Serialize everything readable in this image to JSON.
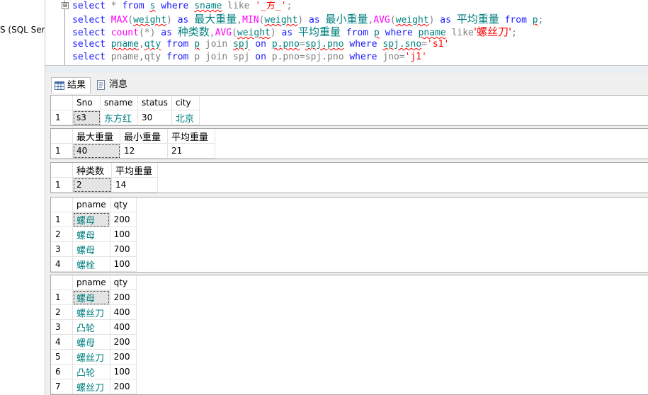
{
  "explorer": {
    "item_label": "S (SQL Ser"
  },
  "editor": {
    "collapse_symbol": "⊟",
    "lines": [
      [
        {
          "t": "select",
          "c": "kw"
        },
        {
          "t": " * ",
          "c": "gray"
        },
        {
          "t": "from",
          "c": "kw"
        },
        {
          "t": " ",
          "c": ""
        },
        {
          "t": "s",
          "c": "id sq"
        },
        {
          "t": " ",
          "c": ""
        },
        {
          "t": "where",
          "c": "kw"
        },
        {
          "t": " ",
          "c": ""
        },
        {
          "t": "sname",
          "c": "id sq"
        },
        {
          "t": " like ",
          "c": "gray"
        },
        {
          "t": "'_方_'",
          "c": "str"
        },
        {
          "t": ";",
          "c": "gray"
        }
      ],
      [
        {
          "t": "select",
          "c": "kw"
        },
        {
          "t": " ",
          "c": ""
        },
        {
          "t": "MAX",
          "c": "fn"
        },
        {
          "t": "(",
          "c": "gray"
        },
        {
          "t": "weight",
          "c": "id sq"
        },
        {
          "t": ") ",
          "c": "gray"
        },
        {
          "t": "as",
          "c": "kw"
        },
        {
          "t": " ",
          "c": ""
        },
        {
          "t": "最大重量",
          "c": "cjk"
        },
        {
          "t": ",",
          "c": "gray"
        },
        {
          "t": "MIN",
          "c": "fn"
        },
        {
          "t": "(",
          "c": "gray"
        },
        {
          "t": "weight",
          "c": "id sq"
        },
        {
          "t": ") ",
          "c": "gray"
        },
        {
          "t": "as",
          "c": "kw"
        },
        {
          "t": " ",
          "c": ""
        },
        {
          "t": "最小重量",
          "c": "cjk"
        },
        {
          "t": ",",
          "c": "gray"
        },
        {
          "t": "AVG",
          "c": "fn"
        },
        {
          "t": "(",
          "c": "gray"
        },
        {
          "t": "weight",
          "c": "id sq"
        },
        {
          "t": ") ",
          "c": "gray"
        },
        {
          "t": "as",
          "c": "kw"
        },
        {
          "t": " ",
          "c": ""
        },
        {
          "t": "平均重量",
          "c": "cjk"
        },
        {
          "t": " ",
          "c": ""
        },
        {
          "t": "from",
          "c": "kw"
        },
        {
          "t": " ",
          "c": ""
        },
        {
          "t": "p",
          "c": "id sq"
        },
        {
          "t": ";",
          "c": "gray"
        }
      ],
      [
        {
          "t": "select",
          "c": "kw"
        },
        {
          "t": " ",
          "c": ""
        },
        {
          "t": "count",
          "c": "fn"
        },
        {
          "t": "(*) ",
          "c": "gray"
        },
        {
          "t": "as",
          "c": "kw"
        },
        {
          "t": " ",
          "c": ""
        },
        {
          "t": "种类数",
          "c": "cjk"
        },
        {
          "t": ",",
          "c": "gray"
        },
        {
          "t": "AVG",
          "c": "fn"
        },
        {
          "t": "(",
          "c": "gray"
        },
        {
          "t": "weight",
          "c": "id sq"
        },
        {
          "t": ") ",
          "c": "gray"
        },
        {
          "t": "as",
          "c": "kw"
        },
        {
          "t": " ",
          "c": ""
        },
        {
          "t": "平均重量",
          "c": "cjk"
        },
        {
          "t": " ",
          "c": ""
        },
        {
          "t": "from",
          "c": "kw"
        },
        {
          "t": " ",
          "c": ""
        },
        {
          "t": "p",
          "c": "id sq"
        },
        {
          "t": " ",
          "c": ""
        },
        {
          "t": "where",
          "c": "kw"
        },
        {
          "t": " ",
          "c": ""
        },
        {
          "t": "pname",
          "c": "id sq"
        },
        {
          "t": " like",
          "c": "gray"
        },
        {
          "t": "'螺丝刀'",
          "c": "cjk-str"
        },
        {
          "t": ";",
          "c": "gray"
        }
      ],
      [
        {
          "t": "select",
          "c": "kw"
        },
        {
          "t": " ",
          "c": ""
        },
        {
          "t": "pname",
          "c": "id sq"
        },
        {
          "t": ",",
          "c": "gray"
        },
        {
          "t": "qty",
          "c": "id sq"
        },
        {
          "t": " ",
          "c": ""
        },
        {
          "t": "from",
          "c": "kw"
        },
        {
          "t": " ",
          "c": ""
        },
        {
          "t": "p",
          "c": "id sq"
        },
        {
          "t": " ",
          "c": ""
        },
        {
          "t": "join",
          "c": "gray"
        },
        {
          "t": " ",
          "c": ""
        },
        {
          "t": "spj",
          "c": "id sq"
        },
        {
          "t": " ",
          "c": ""
        },
        {
          "t": "on",
          "c": "kw"
        },
        {
          "t": " ",
          "c": ""
        },
        {
          "t": "p.pno",
          "c": "id sq"
        },
        {
          "t": "=",
          "c": "gray"
        },
        {
          "t": "spj.pno",
          "c": "id sq"
        },
        {
          "t": " ",
          "c": ""
        },
        {
          "t": "where",
          "c": "kw"
        },
        {
          "t": " ",
          "c": ""
        },
        {
          "t": "spj.sno",
          "c": "id sq"
        },
        {
          "t": "=",
          "c": "gray"
        },
        {
          "t": "'s1'",
          "c": "str"
        }
      ],
      [
        {
          "t": "select",
          "c": "kw"
        },
        {
          "t": " pname,qty ",
          "c": "gray"
        },
        {
          "t": "from",
          "c": "kw"
        },
        {
          "t": " p join spj ",
          "c": "gray"
        },
        {
          "t": "on",
          "c": "kw"
        },
        {
          "t": " p.pno=spj.pno ",
          "c": "gray"
        },
        {
          "t": "where",
          "c": "kw"
        },
        {
          "t": " jno=",
          "c": "gray"
        },
        {
          "t": "'j1'",
          "c": "str"
        }
      ]
    ]
  },
  "tabs": [
    {
      "label": "结果",
      "icon": "grid-results-icon",
      "active": true
    },
    {
      "label": "消息",
      "icon": "messages-icon",
      "active": false
    }
  ],
  "result_sets": [
    {
      "columns": [
        "Sno",
        "sname",
        "status",
        "city"
      ],
      "rows": [
        [
          "s3",
          "东方红",
          "30",
          "北京"
        ]
      ],
      "selected": [
        0,
        0
      ]
    },
    {
      "columns": [
        "最大重量",
        "最小重量",
        "平均重量"
      ],
      "rows": [
        [
          "40",
          "12",
          "21"
        ]
      ],
      "selected": [
        0,
        0
      ]
    },
    {
      "columns": [
        "种类数",
        "平均重量"
      ],
      "rows": [
        [
          "2",
          "14"
        ]
      ],
      "selected": [
        0,
        0
      ]
    },
    {
      "columns": [
        "pname",
        "qty"
      ],
      "rows": [
        [
          "螺母",
          "200"
        ],
        [
          "螺母",
          "100"
        ],
        [
          "螺母",
          "700"
        ],
        [
          "螺栓",
          "100"
        ]
      ],
      "selected": [
        0,
        0
      ]
    },
    {
      "columns": [
        "pname",
        "qty"
      ],
      "rows": [
        [
          "螺母",
          "200"
        ],
        [
          "螺丝刀",
          "400"
        ],
        [
          "凸轮",
          "400"
        ],
        [
          "螺母",
          "200"
        ],
        [
          "螺丝刀",
          "200"
        ],
        [
          "凸轮",
          "100"
        ],
        [
          "螺丝刀",
          "200"
        ]
      ],
      "selected": [
        0,
        0
      ]
    }
  ]
}
